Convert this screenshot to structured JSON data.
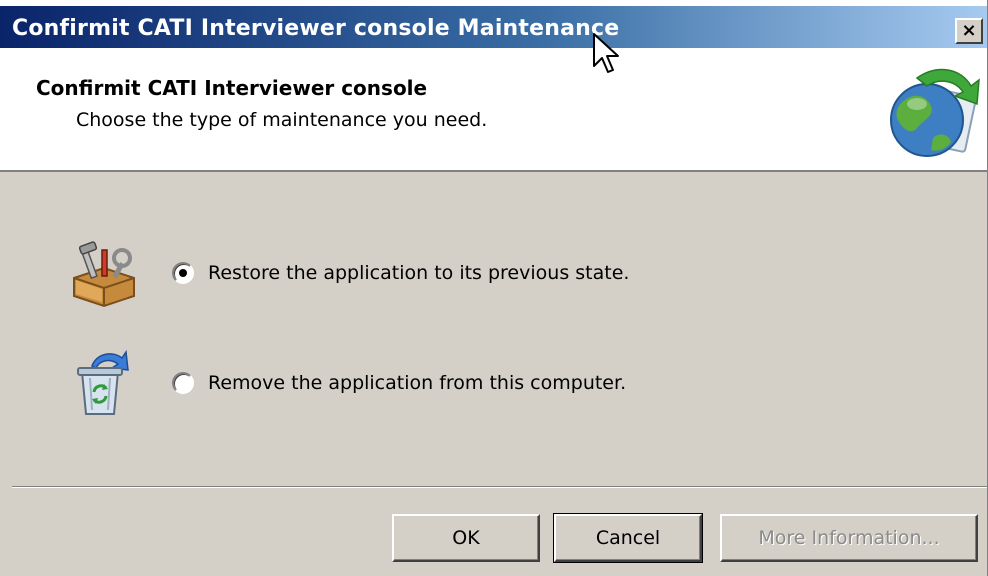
{
  "window": {
    "title": "Confirmit CATI Interviewer console Maintenance",
    "close_glyph": "×"
  },
  "banner": {
    "title": "Confirmit CATI Interviewer console",
    "subtitle": "Choose the type of maintenance you need.",
    "icon": "globe-setup-icon"
  },
  "options": [
    {
      "label": "Restore the application to its previous state.",
      "icon": "toolbox-icon",
      "selected": true
    },
    {
      "label": "Remove the application from this computer.",
      "icon": "recycle-bin-icon",
      "selected": false
    }
  ],
  "buttons": {
    "ok_label": "OK",
    "cancel_label": "Cancel",
    "more_info_label": "More Information...",
    "more_info_disabled": true
  },
  "colors": {
    "title_gradient_start": "#0a246a",
    "title_gradient_end": "#a6caf0",
    "dialog_face": "#d4d0c8"
  }
}
